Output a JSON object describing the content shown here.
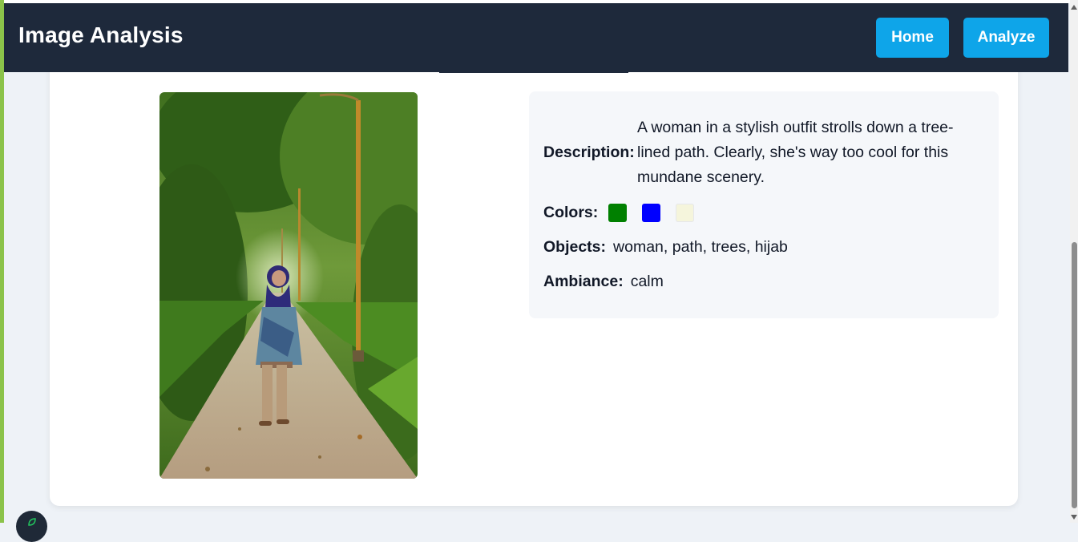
{
  "app": {
    "title": "Image Analysis"
  },
  "nav": {
    "home_label": "Home",
    "analyze_label": "Analyze"
  },
  "analysis": {
    "description_label": "Description:",
    "description": "A woman in a stylish outfit strolls down a tree-lined path. Clearly, she's way too cool for this mundane scenery.",
    "colors_label": "Colors:",
    "colors": [
      "#008000",
      "#0000ff",
      "#f5f5dc"
    ],
    "objects_label": "Objects:",
    "objects": "woman, path, trees, hijab",
    "ambiance_label": "Ambiance:",
    "ambiance": "calm"
  },
  "icons": {
    "fab": "leaf-icon",
    "scroll_up": "scroll-up-arrow-icon",
    "scroll_down": "scroll-down-arrow-icon"
  },
  "theme": {
    "navbar": "#1e293b",
    "accent": "#0ea5e9",
    "page_bg": "#eef2f7",
    "left_accent": "#8bc34a"
  }
}
